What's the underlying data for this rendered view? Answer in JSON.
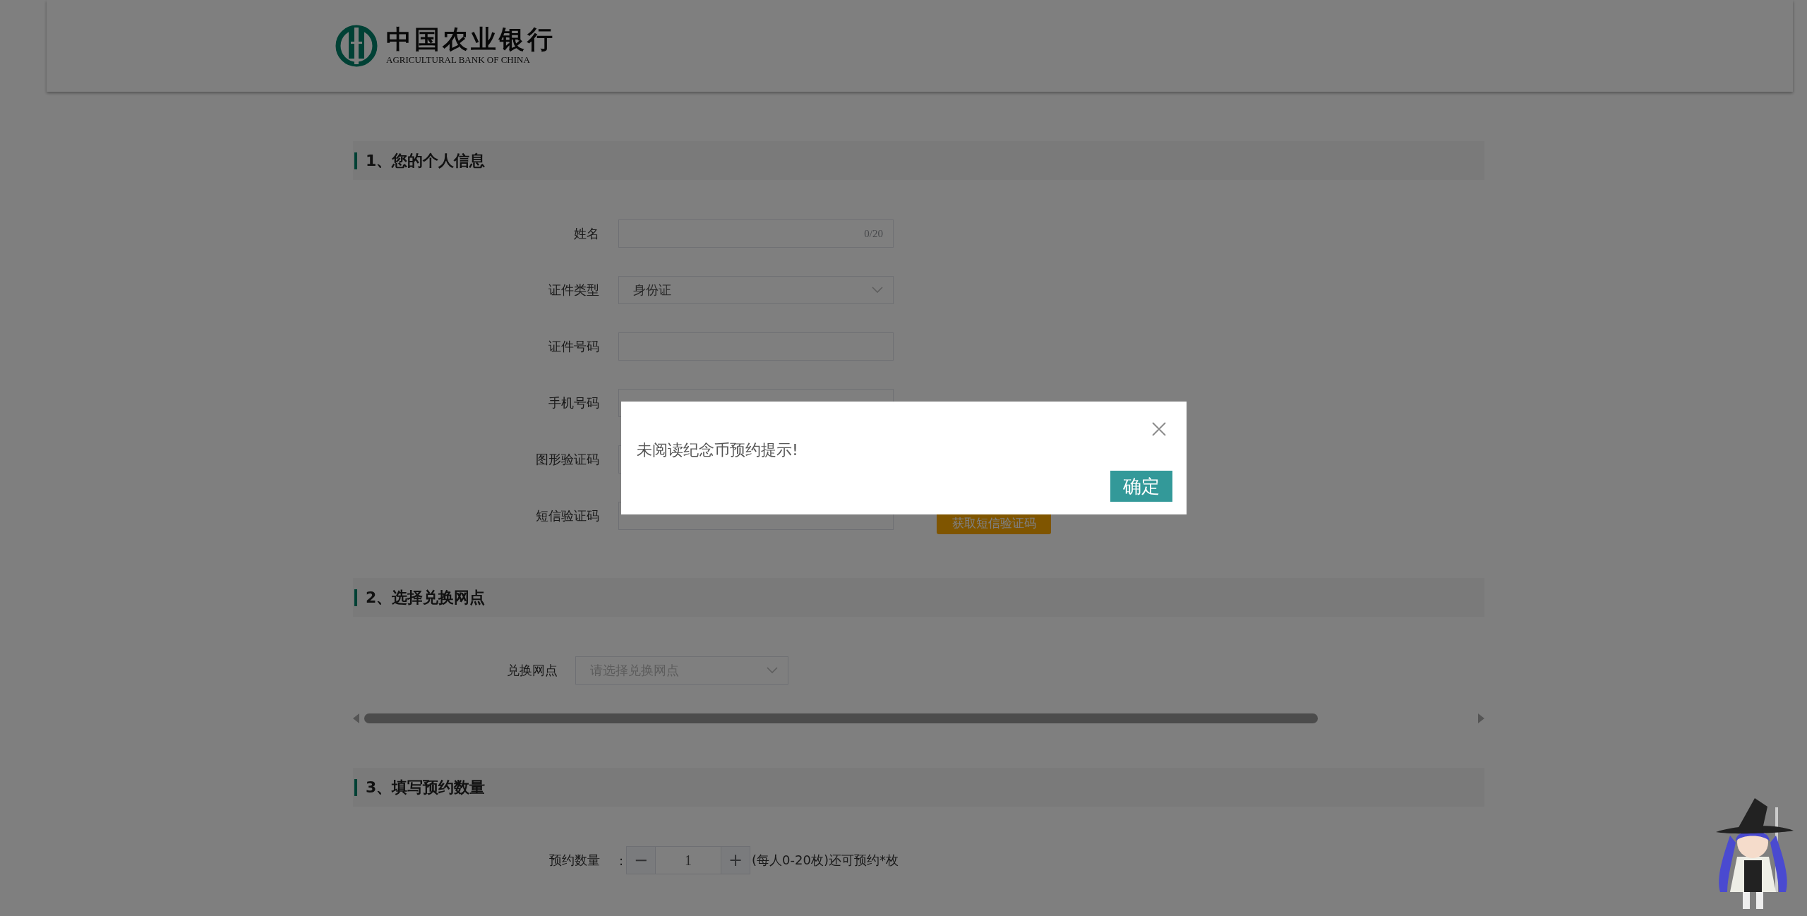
{
  "header": {
    "logo": {
      "name_cn": "中国农业银行",
      "name_en": "AGRICULTURAL BANK OF CHINA"
    }
  },
  "sections": [
    {
      "title": "1、您的个人信息",
      "fields": [
        {
          "kind": "text",
          "label": "姓名",
          "counter": "0/20"
        },
        {
          "kind": "select",
          "label": "证件类型",
          "value": "身份证"
        },
        {
          "kind": "text",
          "label": "证件号码"
        },
        {
          "kind": "text",
          "label": "手机号码"
        },
        {
          "kind": "text",
          "label": "图形验证码"
        },
        {
          "kind": "sms",
          "label": "短信验证码",
          "button": "获取短信验证码"
        }
      ]
    },
    {
      "title": "2、选择兑换网点",
      "fields": [
        {
          "kind": "branch",
          "label": "兑换网点",
          "placeholder": "请选择兑换网点"
        }
      ]
    },
    {
      "title": "3、填写预约数量",
      "fields": [
        {
          "kind": "stepper",
          "label": "预约数量",
          "colon": ":",
          "decrement": "−",
          "value": "1",
          "increment": "+",
          "note": "(每人0-20枚)还可预约*枚"
        }
      ]
    }
  ],
  "dialog": {
    "message": "未阅读纪念币预约提示!",
    "confirm": "确定"
  }
}
